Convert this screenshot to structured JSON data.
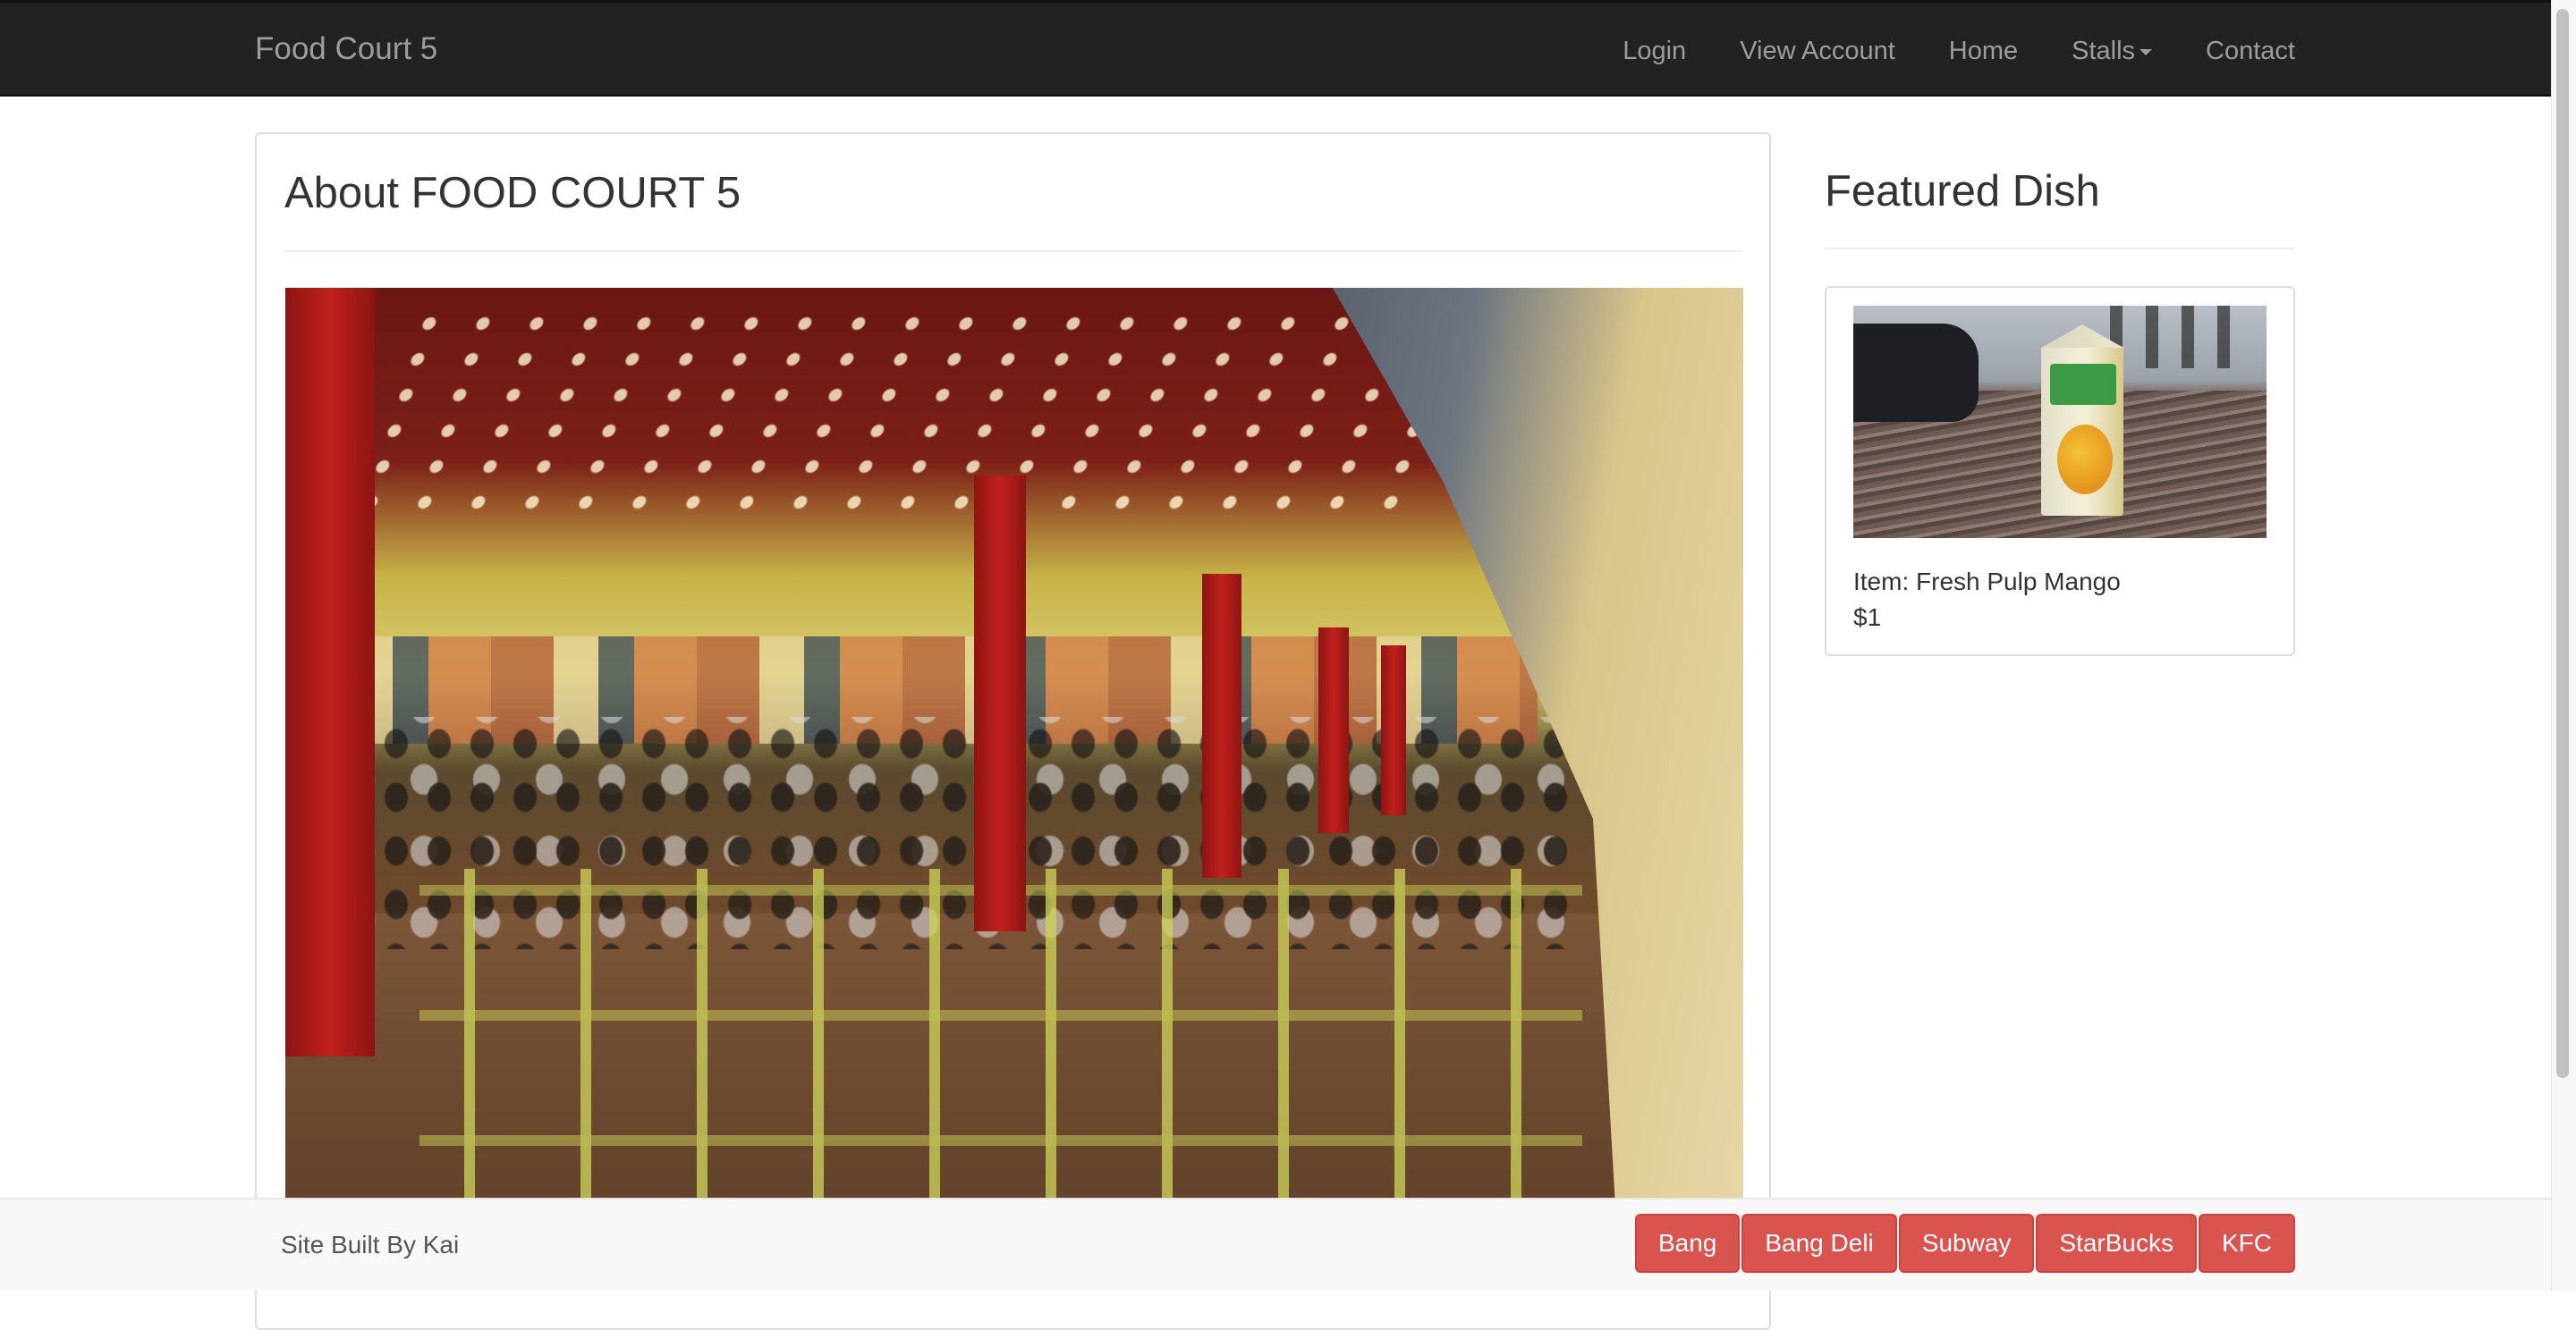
{
  "navbar": {
    "brand": "Food Court 5",
    "items": [
      {
        "label": "Login"
      },
      {
        "label": "View Account"
      },
      {
        "label": "Home"
      },
      {
        "label": "Stalls",
        "dropdown": true
      },
      {
        "label": "Contact"
      }
    ]
  },
  "about": {
    "title": "About FOOD COURT 5"
  },
  "featured": {
    "title": "Featured Dish",
    "item": "Item: Fresh Pulp Mango",
    "price": "$1"
  },
  "footer": {
    "credit": "Site Built By Kai",
    "stall_buttons": [
      "Bang",
      "Bang Deli",
      "Subway",
      "StarBucks",
      "KFC"
    ],
    "button_color": "#d9534f"
  }
}
